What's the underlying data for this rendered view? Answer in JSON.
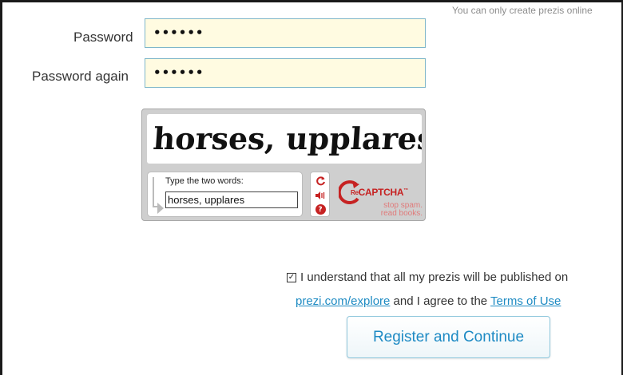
{
  "notice": "You can only create prezis online",
  "form": {
    "password_label": "Password",
    "password_value": "••••••",
    "password_again_label": "Password again",
    "password_again_value": "••••••"
  },
  "captcha": {
    "image_text": "horses, upplares",
    "prompt": "Type the two words:",
    "answer": "horses, upplares",
    "tools": [
      "refresh-icon",
      "audio-icon",
      "help-icon"
    ],
    "logo_prefix": "Re",
    "logo_word": "CAPTCHA",
    "logo_tm": "™",
    "tagline_1": "stop spam.",
    "tagline_2": "read books."
  },
  "terms": {
    "checked": true,
    "line1": "I understand that all my prezis will be published on",
    "explore_link": "prezi.com/explore",
    "middle": " and I agree to the ",
    "terms_link": "Terms of Use"
  },
  "register_button": "Register and Continue",
  "colors": {
    "link": "#1e8bc3",
    "recaptcha_red": "#c62222",
    "input_bg": "#fffbe1",
    "input_border": "#7fb6c9"
  }
}
